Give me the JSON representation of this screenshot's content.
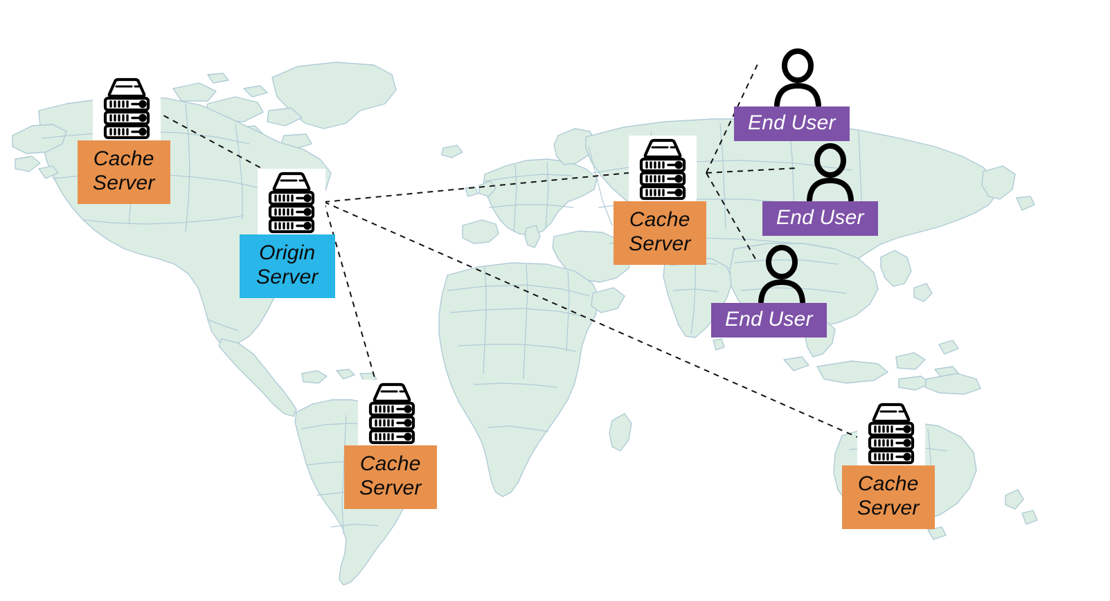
{
  "diagram": {
    "title": "CDN content delivery network world map",
    "background_color": "#ffffff"
  },
  "map": {
    "land_fill": "#dcede4",
    "border_stroke": "#afcbd6",
    "name": "world-map"
  },
  "link_style": {
    "color": "#111111",
    "dash": "8 7",
    "width": 2
  },
  "nodes": [
    {
      "id": "cache-na",
      "icon": "server-rack-icon",
      "label": "Cache\nServer",
      "label_color": "#e8914c",
      "text_color": "#0a0a0a",
      "role": "cache-server",
      "region": "north-america"
    },
    {
      "id": "origin",
      "icon": "server-rack-icon",
      "label": "Origin\nServer",
      "label_color": "#29b6e8",
      "text_color": "#0a0a0a",
      "role": "origin-server",
      "region": "north-america-east"
    },
    {
      "id": "cache-sa",
      "icon": "server-rack-icon",
      "label": "Cache\nServer",
      "label_color": "#e8914c",
      "text_color": "#0a0a0a",
      "role": "cache-server",
      "region": "south-america"
    },
    {
      "id": "cache-eu",
      "icon": "server-rack-icon",
      "label": "Cache\nServer",
      "label_color": "#e8914c",
      "text_color": "#0a0a0a",
      "role": "cache-server",
      "region": "eurasia"
    },
    {
      "id": "cache-au",
      "icon": "server-rack-icon",
      "label": "Cache\nServer",
      "label_color": "#e8914c",
      "text_color": "#0a0a0a",
      "role": "cache-server",
      "region": "australia"
    },
    {
      "id": "user-1",
      "icon": "person-icon",
      "label": "End User",
      "label_color": "#7e52a8",
      "text_color": "#ffffff",
      "role": "end-user",
      "region": "north-asia"
    },
    {
      "id": "user-2",
      "icon": "person-icon",
      "label": "End User",
      "label_color": "#7e52a8",
      "text_color": "#ffffff",
      "role": "end-user",
      "region": "central-asia"
    },
    {
      "id": "user-3",
      "icon": "person-icon",
      "label": "End User",
      "label_color": "#7e52a8",
      "text_color": "#ffffff",
      "role": "end-user",
      "region": "east-asia"
    }
  ],
  "links": [
    {
      "from": "origin",
      "to": "cache-na"
    },
    {
      "from": "origin",
      "to": "cache-sa"
    },
    {
      "from": "origin",
      "to": "cache-eu"
    },
    {
      "from": "origin",
      "to": "cache-au"
    },
    {
      "from": "cache-eu",
      "to": "user-1"
    },
    {
      "from": "cache-eu",
      "to": "user-2"
    },
    {
      "from": "cache-eu",
      "to": "user-3"
    }
  ]
}
